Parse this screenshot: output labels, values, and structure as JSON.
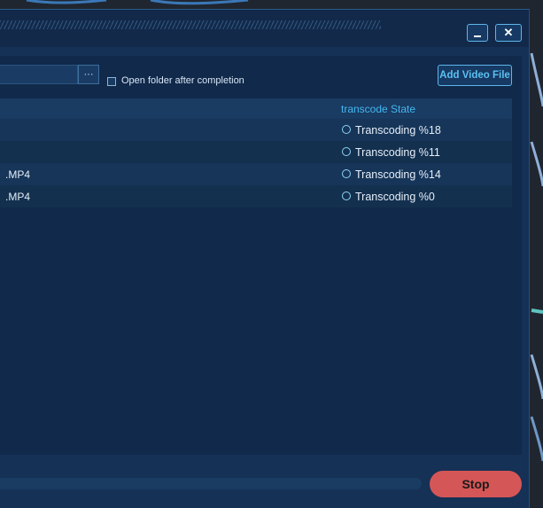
{
  "window": {
    "minimize_icon": "minimize-icon",
    "close_glyph": "✕"
  },
  "toolbar": {
    "browse_label": "···",
    "open_folder_label": "Open folder after completion",
    "open_folder_checked": false,
    "add_video_label": "Add Video File"
  },
  "table": {
    "header_state": "transcode State",
    "rows": [
      {
        "name": "",
        "state": "Transcoding %18"
      },
      {
        "name": "",
        "state": "Transcoding %11"
      },
      {
        "name": ".MP4",
        "state": "Transcoding %14"
      },
      {
        "name": ".MP4",
        "state": "Transcoding %0"
      }
    ]
  },
  "footer": {
    "stop_label": "Stop"
  },
  "colors": {
    "window_bg": "#153156",
    "accent": "#44b7f0",
    "stop": "#d55656"
  }
}
